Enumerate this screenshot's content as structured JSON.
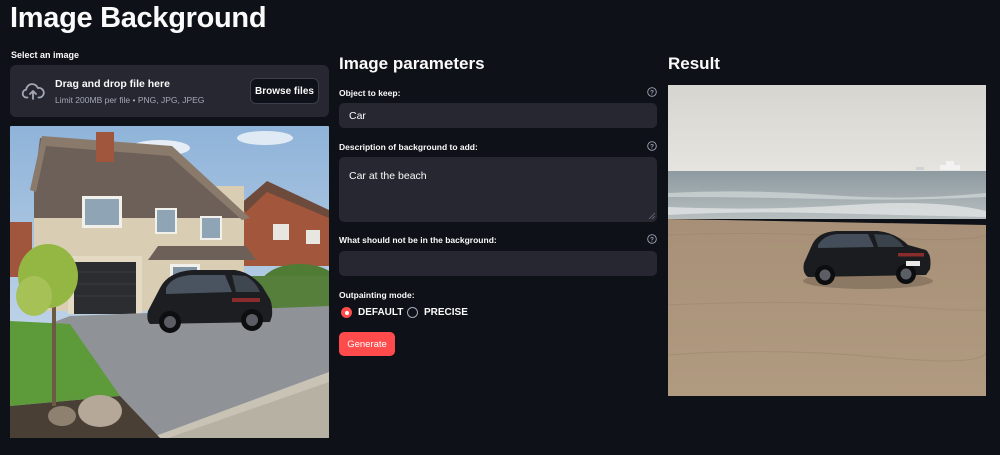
{
  "page": {
    "title": "Image Background"
  },
  "uploader": {
    "label": "Select an image",
    "drop_text": "Drag and drop file here",
    "limit_text": "Limit 200MB per file • PNG, JPG, JPEG",
    "browse_label": "Browse files",
    "icon": "cloud-upload-icon"
  },
  "params": {
    "heading": "Image parameters",
    "object_label": "Object to keep:",
    "object_value": "Car",
    "background_label": "Description of background to add:",
    "background_value": "Car at the beach",
    "negative_label": "What should not be in the background:",
    "negative_value": "",
    "mode_label": "Outpainting mode:",
    "mode_options": [
      "DEFAULT",
      "PRECISE"
    ],
    "mode_selected": "DEFAULT",
    "generate_label": "Generate"
  },
  "result": {
    "heading": "Result"
  },
  "colors": {
    "background": "#0e1117",
    "widget": "#262730",
    "accent": "#ff4b4b",
    "text": "#fafafa",
    "muted": "#a3a8b8"
  }
}
